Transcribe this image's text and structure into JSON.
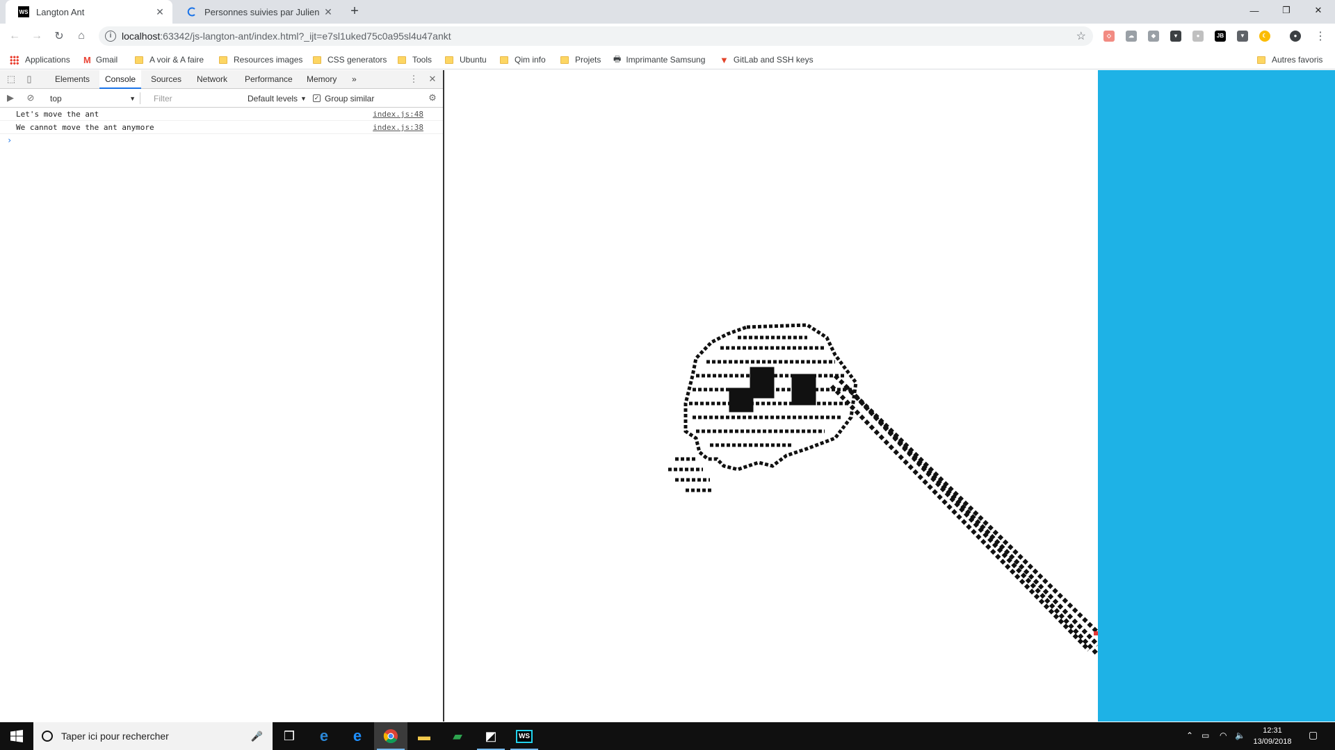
{
  "tabs": [
    {
      "title": "Langton Ant",
      "icon": "webstorm-icon",
      "active": true
    },
    {
      "title": "Personnes suivies par Julien Roch",
      "icon": "loading-icon",
      "active": false
    }
  ],
  "url": {
    "host": "localhost",
    "path": ":63342/js-langton-ant/index.html?_ijt=e7sl1uked75c0a95sl4u47ankt"
  },
  "bookmarks": [
    {
      "label": "Applications",
      "icon": "apps-icon"
    },
    {
      "label": "Gmail",
      "icon": "gmail-icon"
    },
    {
      "label": "A voir & A faire",
      "icon": "folder-icon"
    },
    {
      "label": "Resources images",
      "icon": "folder-icon"
    },
    {
      "label": "CSS generators",
      "icon": "folder-icon"
    },
    {
      "label": "Tools",
      "icon": "folder-icon"
    },
    {
      "label": "Ubuntu",
      "icon": "folder-icon"
    },
    {
      "label": "Qim info",
      "icon": "folder-icon"
    },
    {
      "label": "Projets",
      "icon": "folder-icon"
    },
    {
      "label": "Imprimante Samsung",
      "icon": "printer-icon"
    },
    {
      "label": "GitLab and SSH keys",
      "icon": "gitlab-icon"
    }
  ],
  "other_bookmarks": "Autres favoris",
  "devtools": {
    "tabs": [
      "Elements",
      "Console",
      "Sources",
      "Network",
      "Performance",
      "Memory"
    ],
    "active_tab": "Console",
    "more": "»",
    "context": "top",
    "filter_placeholder": "Filter",
    "levels": "Default levels",
    "group_similar": "Group similar",
    "messages": [
      {
        "text": "Let's move the ant",
        "source": "index.js:48"
      },
      {
        "text": "We cannot move the ant anymore",
        "source": "index.js:38"
      }
    ],
    "prompt": "›"
  },
  "taskbar": {
    "search_placeholder": "Taper ici pour rechercher",
    "time": "12:31",
    "date": "13/09/2018"
  },
  "colors": {
    "panel": "#1eb2e6",
    "ant_cells": "#111111"
  }
}
